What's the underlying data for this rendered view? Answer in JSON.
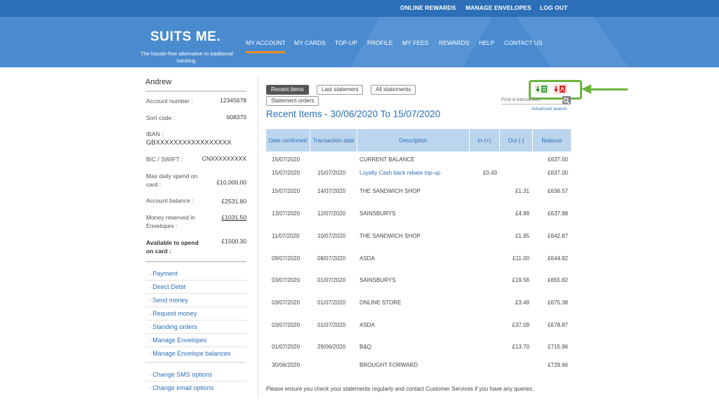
{
  "top_links": [
    "ONLINE REWARDS",
    "MANAGE ENVELOPES",
    "LOG OUT"
  ],
  "brand": {
    "logo": "SUITS ME.",
    "tagline": "The hassle-free alternative to traditional banking."
  },
  "nav": [
    "MY ACCOUNT",
    "MY CARDS",
    "TOP-UP",
    "PROFILE",
    "MY FEES",
    "REWARDS",
    "HELP",
    "CONTACT US"
  ],
  "account": {
    "user_name": "Andrew",
    "account_number_label": "Account number :",
    "account_number": "12345678",
    "sort_code_label": "Sort code :",
    "sort_code": "608370",
    "iban_label": "IBAN :",
    "iban": "GBXXXXXXXXXXXXXXXXX",
    "bic_label": "BIC / SWIFT :",
    "bic": "CNXXXXXXXXX",
    "max_daily_label": "Max daily spend on card :",
    "max_daily": "£10,000.00",
    "balance_label": "Account balance :",
    "balance": "£2531.80",
    "reserved_label": "Money reserved in Envelopes :",
    "reserved": "£1031.50",
    "available_label": "Available to spend on card :",
    "available": "£1500.30"
  },
  "sidebar_links": [
    "Payment",
    "Direct Debit",
    "Send money",
    "Request money",
    "Standing orders",
    "Manage Envelopes",
    "Manage Envelope balances"
  ],
  "sidebar_links_2": [
    "Change SMS options",
    "Change email options"
  ],
  "tabs": [
    "Recent items",
    "Last statement",
    "All statements",
    "Statement orders"
  ],
  "search": {
    "placeholder": "Find a transaction",
    "advanced": "Advanced search"
  },
  "download_icons": [
    "download-excel-icon",
    "download-pdf-icon"
  ],
  "heading": "Recent Items - 30/06/2020 To 15/07/2020",
  "table_headers": [
    "Date confirmed",
    "Transaction date",
    "Description",
    "In (+)",
    "Out (-)",
    "Balance"
  ],
  "transactions": [
    {
      "confirmed": "15/07/2020",
      "tdate": "",
      "desc": "CURRENT BALANCE",
      "in": "",
      "out": "",
      "balance": "£637.00"
    },
    {
      "confirmed": "15/07/2020",
      "tdate": "15/07/2020",
      "desc": "Loyalty Cash back rebate top-up",
      "in": "£0.43",
      "out": "",
      "balance": "£637.00"
    },
    {
      "confirmed": "15/07/2020",
      "tdate": "14/07/2020",
      "desc": "THE SANDWICH SHOP",
      "in": "",
      "out": "£1.31",
      "balance": "£636.57"
    },
    {
      "confirmed": "13/07/2020",
      "tdate": "12/07/2020",
      "desc": "SAINSBURYS",
      "in": "",
      "out": "£4.99",
      "balance": "£637.88"
    },
    {
      "confirmed": "11/07/2020",
      "tdate": "10/07/2020",
      "desc": "THE SANDWICH SHOP",
      "in": "",
      "out": "£1.95",
      "balance": "£642.87"
    },
    {
      "confirmed": "09/07/2020",
      "tdate": "08/07/2020",
      "desc": "ASDA",
      "in": "",
      "out": "£11.00",
      "balance": "£644.82"
    },
    {
      "confirmed": "03/07/2020",
      "tdate": "01/07/2020",
      "desc": "SAINSBURYS",
      "in": "",
      "out": "£19.56",
      "balance": "£655.82"
    },
    {
      "confirmed": "03/07/2020",
      "tdate": "01/07/2020",
      "desc": "ONLINE STORE",
      "in": "",
      "out": "£3.49",
      "balance": "£675.38"
    },
    {
      "confirmed": "03/07/2020",
      "tdate": "01/07/2020",
      "desc": "ASDA",
      "in": "",
      "out": "£37.09",
      "balance": "£678.87"
    },
    {
      "confirmed": "01/07/2020",
      "tdate": "29/06/2020",
      "desc": "B&Q",
      "in": "",
      "out": "£13.70",
      "balance": "£715.96"
    },
    {
      "confirmed": "30/06/2020",
      "tdate": "",
      "desc": "BROUGHT FORWARD",
      "in": "",
      "out": "",
      "balance": "£729.66"
    }
  ],
  "footer_note": "Please ensure you check your statements regularly and contact Customer Services if you have any queries.",
  "colors": {
    "brand_blue": "#2c6fb7",
    "banner_blue": "#4a8bd0",
    "accent_orange": "#f08a24",
    "highlight_green": "#6cb33f",
    "table_header": "#bcd5ee"
  }
}
